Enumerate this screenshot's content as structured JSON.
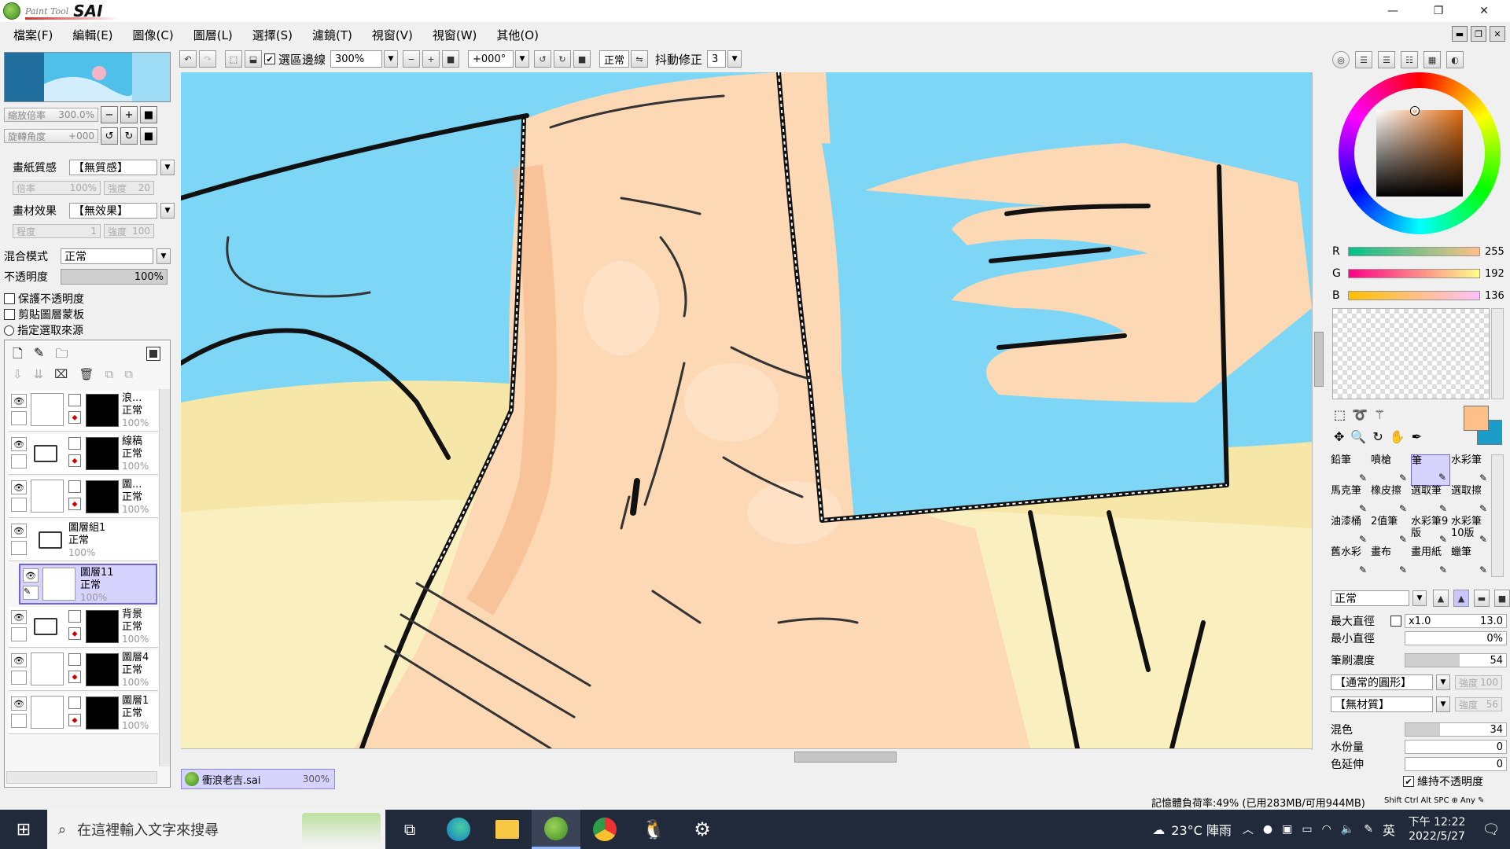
{
  "app": {
    "logo_small": "Paint Tool",
    "logo_big": "SAI"
  },
  "window_buttons": {
    "minimize": "—",
    "restore": "❐",
    "close": "✕"
  },
  "menu": [
    "檔案(F)",
    "編輯(E)",
    "圖像(C)",
    "圖層(L)",
    "選擇(S)",
    "濾鏡(T)",
    "視窗(V)",
    "視窗(W)",
    "其他(O)"
  ],
  "toolbar": {
    "selection_edge_label": "選區邊線",
    "selection_edge_checked": true,
    "zoom_value": "300%",
    "rotate_value": "+000°",
    "blend_mode": "正常",
    "stabilizer_label": "抖動修正",
    "stabilizer_value": "3"
  },
  "navigator": {
    "zoom_label": "縮放倍率",
    "zoom_value": "300.0%",
    "angle_label": "旋轉角度",
    "angle_value": "+000"
  },
  "layer_props": {
    "paper_texture_label": "畫紙質感",
    "paper_texture_value": "【無質感】",
    "scale_label": "倍率",
    "scale_value": "100%",
    "strength_label": "強度",
    "strength_value": "20",
    "effect_label": "畫材效果",
    "effect_value": "【無效果】",
    "degree_label": "程度",
    "degree_value": "1",
    "strength2_label": "強度",
    "strength2_value": "100",
    "blend_label": "混合模式",
    "blend_value": "正常",
    "opacity_label": "不透明度",
    "opacity_value": "100%",
    "opacity_fraction": 1.0,
    "preserve_opacity": "保護不透明度",
    "clipping": "剪貼圖層蒙板",
    "selection_source": "指定選取來源"
  },
  "layers": [
    {
      "name": "浪...",
      "mode": "正常",
      "opacity": "100%",
      "type": "layer"
    },
    {
      "name": "線稿",
      "mode": "正常",
      "opacity": "100%",
      "type": "folder"
    },
    {
      "name": "圖...",
      "mode": "正常",
      "opacity": "100%",
      "type": "layer"
    },
    {
      "name": "圖層組1",
      "mode": "正常",
      "opacity": "100%",
      "type": "group"
    },
    {
      "name": "圖層11",
      "mode": "正常",
      "opacity": "100%",
      "type": "layer",
      "selected": true
    },
    {
      "name": "背景",
      "mode": "正常",
      "opacity": "100%",
      "type": "folder"
    },
    {
      "name": "圖層4",
      "mode": "正常",
      "opacity": "100%",
      "type": "layer"
    },
    {
      "name": "圖層1",
      "mode": "正常",
      "opacity": "100%",
      "type": "layer"
    }
  ],
  "file_tab": {
    "name": "衝浪老吉.sai",
    "zoom": "300%"
  },
  "color": {
    "r_label": "R",
    "r_value": "255",
    "g_label": "G",
    "g_value": "192",
    "b_label": "B",
    "b_value": "136",
    "primary": "#ffc088",
    "secondary": "#1a9dc8"
  },
  "tools": [
    {
      "label": "鉛筆"
    },
    {
      "label": "噴槍"
    },
    {
      "label": "筆",
      "selected": true
    },
    {
      "label": "水彩筆"
    },
    {
      "label": "馬克筆"
    },
    {
      "label": "橡皮擦"
    },
    {
      "label": "選取筆"
    },
    {
      "label": "選取擦"
    },
    {
      "label": "油漆桶"
    },
    {
      "label": "2值筆"
    },
    {
      "label": "水彩筆9版"
    },
    {
      "label": "水彩筆10版"
    },
    {
      "label": "舊水彩"
    },
    {
      "label": "畫布"
    },
    {
      "label": "畫用紙"
    },
    {
      "label": "蠟筆"
    }
  ],
  "brush": {
    "mode": "正常",
    "max_diameter_label": "最大直徑",
    "max_diameter_mult": "x1.0",
    "max_diameter_value": "13.0",
    "min_diameter_label": "最小直徑",
    "min_diameter_value": "0%",
    "density_label": "筆刷濃度",
    "density_value": "54",
    "shape_value": "【通常的圓形】",
    "shape_strength_label": "強度",
    "shape_strength_value": "100",
    "texture_value": "【無材質】",
    "texture_strength_label": "強度",
    "texture_strength_value": "56",
    "blend_label": "混色",
    "blend_value": "34",
    "water_label": "水份量",
    "water_value": "0",
    "persistence_label": "色延伸",
    "persistence_value": "0",
    "keep_opacity_label": "維持不透明度"
  },
  "status": {
    "memory": "記憶體負荷率:49% (已用283MB/可用944MB)",
    "keys": [
      "Shift",
      "Ctrl",
      "Alt",
      "SPC",
      "Any"
    ]
  },
  "taskbar": {
    "search_placeholder": "在這裡輸入文字來搜尋",
    "weather": "23°C 陣雨",
    "ime": "英",
    "time": "下午 12:22",
    "date": "2022/5/27"
  }
}
